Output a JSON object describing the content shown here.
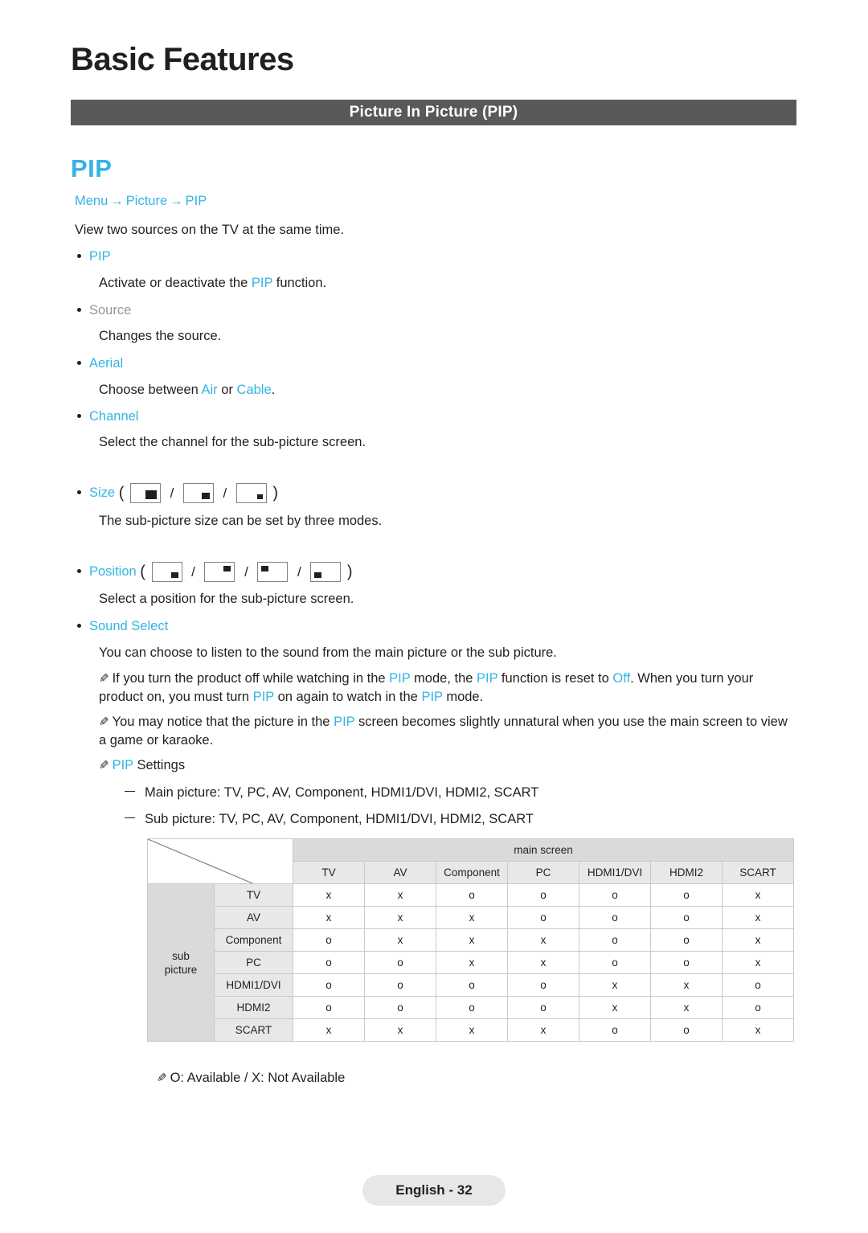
{
  "page": {
    "title": "Basic Features",
    "section_bar": "Picture In Picture (PIP)",
    "heading": "PIP",
    "breadcrumb": {
      "menu": "Menu",
      "picture": "Picture",
      "pip": "PIP",
      "arrow": "→"
    },
    "intro": "View two sources on the TV at the same time.",
    "footer": "English - 32"
  },
  "items": [
    {
      "label": "PIP",
      "desc_pre": "Activate or deactivate the ",
      "desc_link": "PIP",
      "desc_post": " function."
    },
    {
      "label": "Source",
      "desc": "Changes the source."
    },
    {
      "label": "Aerial",
      "desc_pre": "Choose between ",
      "opt1": "Air",
      "desc_mid": " or ",
      "opt2": "Cable",
      "desc_post": "."
    },
    {
      "label": "Channel",
      "desc": "Select the channel for the sub-picture screen."
    },
    {
      "label": "Size",
      "desc": "The sub-picture size can be set by three modes."
    },
    {
      "label": "Position",
      "desc": "Select a position for the sub-picture screen."
    },
    {
      "label": "Sound Select",
      "desc": "You can choose to listen to the sound from the main picture or the sub picture."
    }
  ],
  "notes": [
    {
      "seg": [
        {
          "t": "If you turn the product off while watching in the ",
          "c": "dark"
        },
        {
          "t": "PIP",
          "c": "cyan"
        },
        {
          "t": " mode, the ",
          "c": "dark"
        },
        {
          "t": "PIP",
          "c": "cyan"
        },
        {
          "t": " function is reset to ",
          "c": "dark"
        },
        {
          "t": "Off",
          "c": "cyan"
        },
        {
          "t": ". When you turn your product on, you must turn ",
          "c": "dark"
        },
        {
          "t": "PIP",
          "c": "cyan"
        },
        {
          "t": " on again to watch in the ",
          "c": "dark"
        },
        {
          "t": "PIP",
          "c": "cyan"
        },
        {
          "t": " mode.",
          "c": "dark"
        }
      ]
    },
    {
      "seg": [
        {
          "t": "You may notice that the picture in the ",
          "c": "dark"
        },
        {
          "t": "PIP",
          "c": "cyan"
        },
        {
          "t": " screen becomes slightly unnatural when you use the main screen to view a game or karaoke.",
          "c": "dark"
        }
      ]
    }
  ],
  "settings": {
    "title_link": "PIP",
    "title_rest": " Settings",
    "lines": [
      "Main picture: TV, PC, AV, Component, HDMI1/DVI, HDMI2, SCART",
      "Sub picture: TV, PC, AV, Component, HDMI1/DVI, HDMI2, SCART"
    ]
  },
  "table": {
    "main_header": "main screen",
    "row_group_label": "sub\npicture",
    "columns": [
      "TV",
      "AV",
      "Component",
      "PC",
      "HDMI1/DVI",
      "HDMI2",
      "SCART"
    ],
    "rows": [
      {
        "label": "TV",
        "values": [
          "x",
          "x",
          "o",
          "o",
          "o",
          "o",
          "x"
        ]
      },
      {
        "label": "AV",
        "values": [
          "x",
          "x",
          "x",
          "o",
          "o",
          "o",
          "x"
        ]
      },
      {
        "label": "Component",
        "values": [
          "o",
          "x",
          "x",
          "x",
          "o",
          "o",
          "x"
        ]
      },
      {
        "label": "PC",
        "values": [
          "o",
          "o",
          "x",
          "x",
          "o",
          "o",
          "x"
        ]
      },
      {
        "label": "HDMI1/DVI",
        "values": [
          "o",
          "o",
          "o",
          "o",
          "x",
          "x",
          "o"
        ]
      },
      {
        "label": "HDMI2",
        "values": [
          "o",
          "o",
          "o",
          "o",
          "x",
          "x",
          "o"
        ]
      },
      {
        "label": "SCART",
        "values": [
          "x",
          "x",
          "x",
          "x",
          "o",
          "o",
          "x"
        ]
      }
    ],
    "legend": "O: Available / X: Not Available"
  },
  "colors": {
    "accent": "#33b4e5",
    "bar": "#58595b",
    "text": "#231f20",
    "gray": "#939598"
  }
}
